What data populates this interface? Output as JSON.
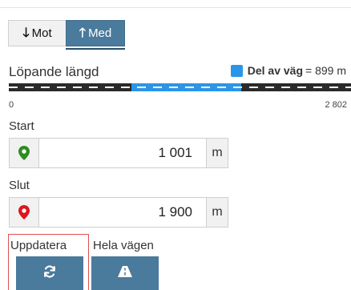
{
  "direction": {
    "mot_label": "Mot",
    "med_label": "Med",
    "selected": "Med"
  },
  "length": {
    "title": "Löpande längd",
    "legend_label": "Del av väg",
    "legend_value": "= 899 m",
    "legend_color": "#2b95e8",
    "road_min": 0,
    "road_max": 2802,
    "highlight_start": 1001,
    "highlight_end": 1900,
    "tick_min_label": "0",
    "tick_max_label": "2 802"
  },
  "start": {
    "label": "Start",
    "value": "1 001",
    "unit": "m",
    "icon": "map-marker-green-icon",
    "icon_color": "#2e8b1e"
  },
  "end": {
    "label": "Slut",
    "value": "1 900",
    "unit": "m",
    "icon": "map-marker-red-icon",
    "icon_color": "#e0141e"
  },
  "actions": {
    "update_label": "Uppdatera",
    "whole_road_label": "Hela vägen",
    "update_icon": "refresh-icon",
    "whole_road_icon": "road-icon"
  }
}
